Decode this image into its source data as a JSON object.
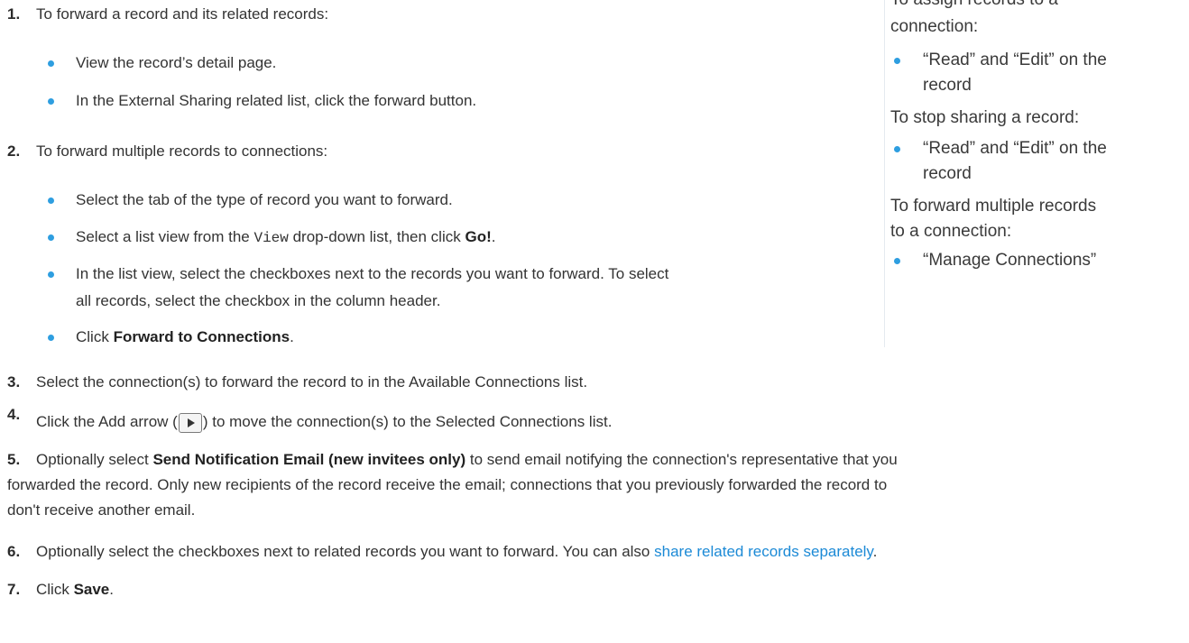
{
  "steps": [
    {
      "num": "1.",
      "text": "To forward a record and its related records:"
    },
    {
      "num": "2.",
      "text": "To forward multiple records to connections:"
    },
    {
      "num": "3.",
      "text": "Select the connection(s) to forward the record to in the Available Connections list."
    },
    {
      "num": "4.",
      "text_before": "Click the Add arrow (",
      "text_after": ") to move the connection(s) to the Selected Connections list."
    },
    {
      "num": "5.",
      "text_before": "Optionally select ",
      "bold": "Send Notification Email (new invitees only)",
      "line1_after": " to send email notifying the connection's representative that you",
      "line2": "forwarded the record. Only new recipients of the record receive the email; connections that you previously forwarded the record to",
      "line3": "don't receive another email."
    },
    {
      "num": "6.",
      "text_before": "Optionally select the checkboxes next to related records you want to forward. You can also ",
      "link": "share related records separately",
      "text_after": "."
    },
    {
      "num": "7.",
      "text_before": "Click ",
      "bold": "Save",
      "text_after": "."
    }
  ],
  "step1_bullets": [
    "View the record’s detail page.",
    "In the External Sharing related list, click the forward button."
  ],
  "step2_bullets": {
    "b1": "Select the tab of the type of record you want to forward.",
    "b2_before": "Select a list view from the ",
    "b2_mono": "View",
    "b2_mid": " drop-down list, then click ",
    "b2_bold": "Go!",
    "b2_after": ".",
    "b3_line1": "In the list view, select the checkboxes next to the records you want to forward. To select",
    "b3_line2": "all records, select the checkbox in the column header.",
    "b4_before": "Click ",
    "b4_bold": "Forward to Connections",
    "b4_after": "."
  },
  "sidebar": {
    "assign_line1": "To assign records to a",
    "assign_line2": "connection:",
    "assign_bullet_line1": "“Read” and “Edit” on the",
    "assign_bullet_line2": "record",
    "stop_heading": "To stop sharing a record:",
    "stop_bullet_line1": "“Read” and “Edit” on the",
    "stop_bullet_line2": "record",
    "forward_line1": "To forward multiple records",
    "forward_line2": "to a connection:",
    "forward_bullet": "“Manage Connections”"
  },
  "colors": {
    "bullet": "#2e9ee0",
    "link": "#1c8ad6",
    "text": "#333333"
  },
  "icons": {
    "add_arrow": "add-arrow-icon"
  }
}
